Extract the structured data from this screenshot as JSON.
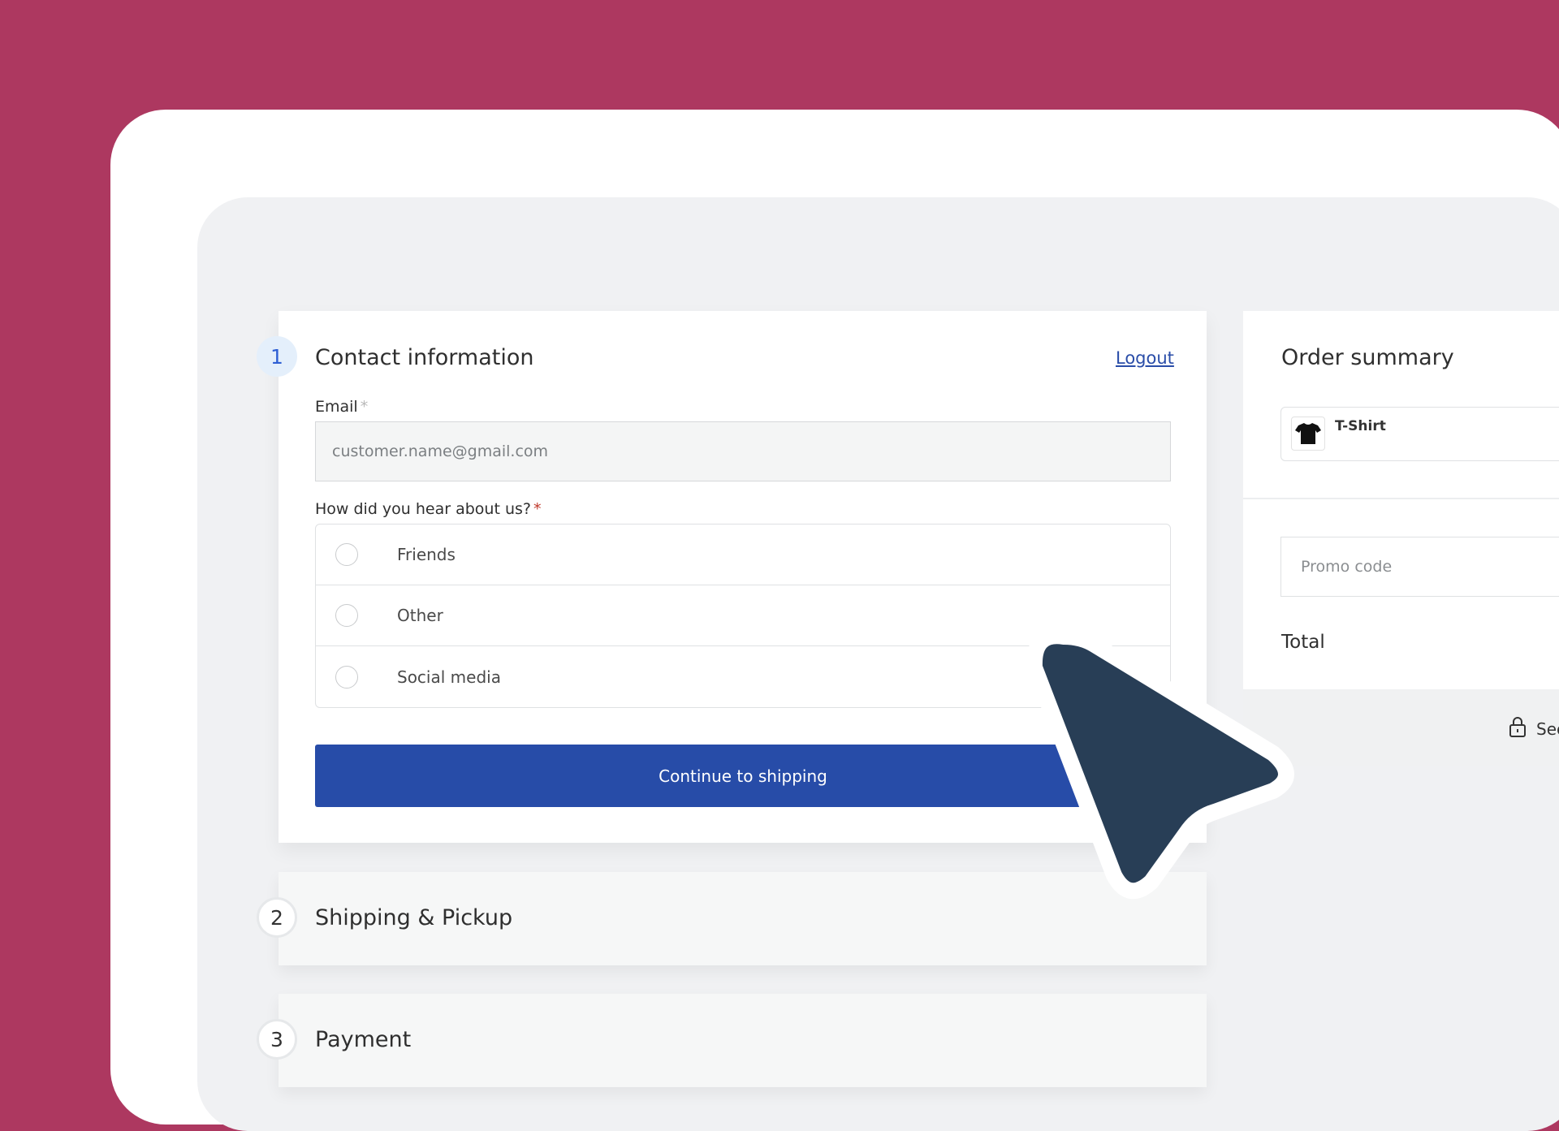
{
  "colors": {
    "background": "#ad3860",
    "primary_button": "#274ca8",
    "link": "#2a4da8",
    "active_step": "#2e5fd4",
    "cursor": "#283e56"
  },
  "steps": [
    {
      "number": "1",
      "title": "Contact information",
      "state": "active"
    },
    {
      "number": "2",
      "title": "Shipping & Pickup",
      "state": "collapsed"
    },
    {
      "number": "3",
      "title": "Payment",
      "state": "collapsed"
    }
  ],
  "contact": {
    "logout_label": "Logout",
    "email": {
      "label": "Email",
      "required_mark": "*",
      "value": "customer.name@gmail.com"
    },
    "referral": {
      "label": "How did you hear about us?",
      "required_mark": "*",
      "options": [
        "Friends",
        "Other",
        "Social media"
      ]
    },
    "continue_label": "Continue to shipping"
  },
  "summary": {
    "title": "Order summary",
    "item": {
      "name": "T-Shirt",
      "icon": "t-shirt-icon"
    },
    "promo_placeholder": "Promo code",
    "total_label": "Total",
    "secure_text": "Sec"
  },
  "cursor": {
    "icon": "pointer-arrow-icon"
  }
}
